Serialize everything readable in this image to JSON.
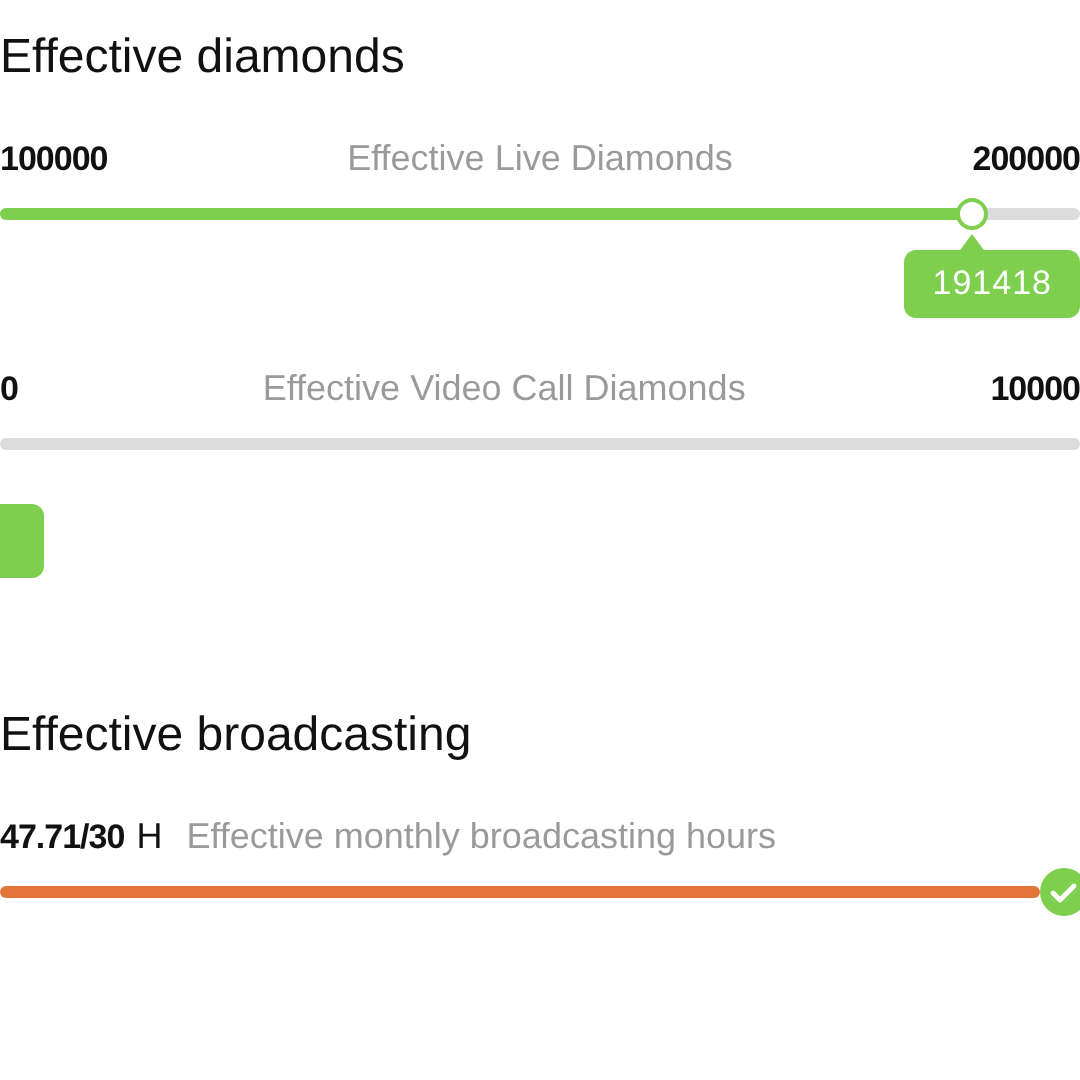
{
  "sections": [
    {
      "title": "Effective diamonds",
      "bars": [
        {
          "kind": "range",
          "min_label": "100000",
          "label": "Effective Live Diamonds",
          "max_label": "200000",
          "level": 0.9,
          "color": "#7fcf4f",
          "thumb": true,
          "badge": "191418",
          "complete": false
        },
        {
          "kind": "range",
          "min_label": "0",
          "label": "Effective Video Call Diamonds",
          "max_label": "10000",
          "thumb": false,
          "complete": false
        }
      ],
      "action_button": {
        "enabled": true
      }
    },
    {
      "title": "Effective broadcasting",
      "bars": [
        {
          "kind": "hours",
          "value": "47.71/30",
          "unit": "H",
          "label": "Effective monthly broadcasting hours",
          "level": 1,
          "color": "#e4743a",
          "thumb": false,
          "complete": true
        }
      ]
    }
  ]
}
